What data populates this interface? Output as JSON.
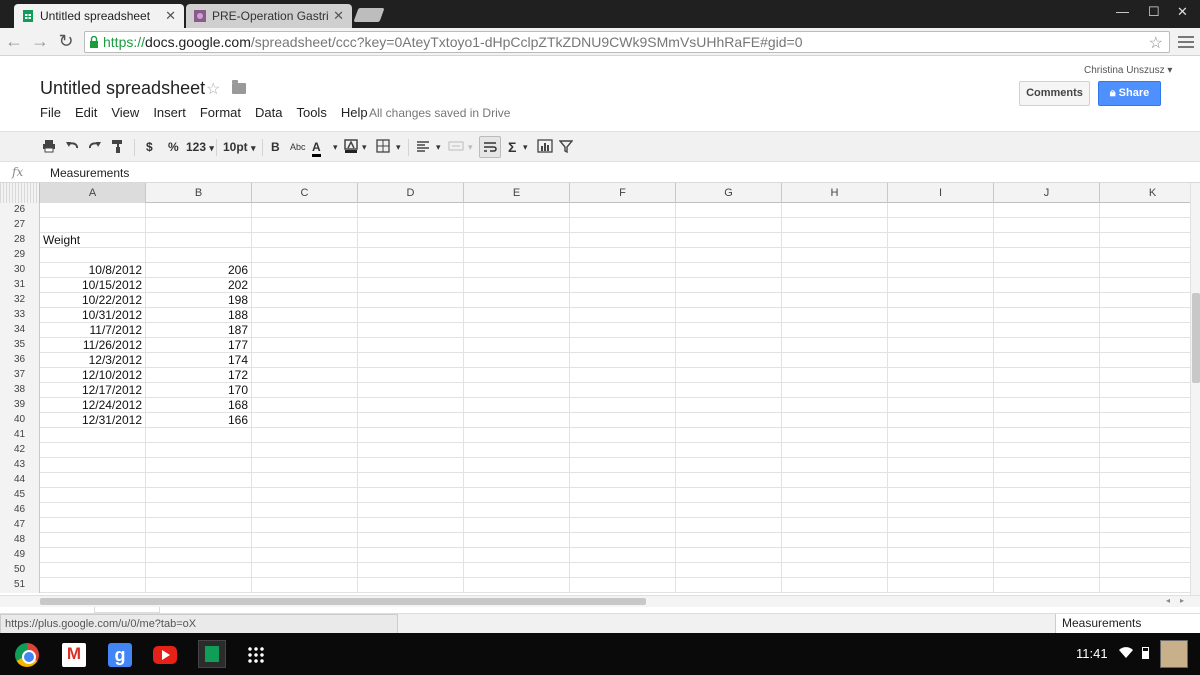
{
  "browser": {
    "tabs": [
      {
        "title": "Untitled spreadsheet",
        "active": true
      },
      {
        "title": "PRE-Operation Gastric Sl",
        "active": false
      }
    ],
    "url": {
      "scheme": "https://",
      "host": "docs.google.com",
      "rest": "/spreadsheet/ccc?key=0AteyTxtoyo1-dHpCclpZTkZDNU9CWk9SMmVsUHhRaFE#gid=0"
    }
  },
  "doc": {
    "title": "Untitled spreadsheet",
    "menu": [
      "File",
      "Edit",
      "View",
      "Insert",
      "Format",
      "Data",
      "Tools",
      "Help"
    ],
    "saved_status": "All changes saved in Drive",
    "user": "Christina Unszusz",
    "comments_label": "Comments",
    "share_label": "Share"
  },
  "toolbar": {
    "currency": "$",
    "percent": "%",
    "number_format": "123",
    "font_size": "10pt",
    "bold": "B",
    "strike": "Abc",
    "text_color": "A",
    "sum": "Σ"
  },
  "formula_bar": {
    "fx": "fx",
    "content": "Measurements"
  },
  "grid": {
    "columns": [
      "A",
      "B",
      "C",
      "D",
      "E",
      "F",
      "G",
      "H",
      "I",
      "J",
      "K"
    ],
    "selected_column": "A",
    "rows": [
      {
        "num": "26",
        "a": "",
        "b": ""
      },
      {
        "num": "27",
        "a": "",
        "b": ""
      },
      {
        "num": "28",
        "a": "Weight",
        "b": "",
        "a_align": "left"
      },
      {
        "num": "29",
        "a": "",
        "b": ""
      },
      {
        "num": "30",
        "a": "10/8/2012",
        "b": "206"
      },
      {
        "num": "31",
        "a": "10/15/2012",
        "b": "202"
      },
      {
        "num": "32",
        "a": "10/22/2012",
        "b": "198"
      },
      {
        "num": "33",
        "a": "10/31/2012",
        "b": "188"
      },
      {
        "num": "34",
        "a": "11/7/2012",
        "b": "187"
      },
      {
        "num": "35",
        "a": "11/26/2012",
        "b": "177"
      },
      {
        "num": "36",
        "a": "12/3/2012",
        "b": "174"
      },
      {
        "num": "37",
        "a": "12/10/2012",
        "b": "172"
      },
      {
        "num": "38",
        "a": "12/17/2012",
        "b": "170"
      },
      {
        "num": "39",
        "a": "12/24/2012",
        "b": "168"
      },
      {
        "num": "40",
        "a": "12/31/2012",
        "b": "166"
      },
      {
        "num": "41",
        "a": "",
        "b": ""
      },
      {
        "num": "42",
        "a": "",
        "b": ""
      },
      {
        "num": "43",
        "a": "",
        "b": ""
      },
      {
        "num": "44",
        "a": "",
        "b": ""
      },
      {
        "num": "45",
        "a": "",
        "b": ""
      },
      {
        "num": "46",
        "a": "",
        "b": ""
      },
      {
        "num": "47",
        "a": "",
        "b": ""
      },
      {
        "num": "48",
        "a": "",
        "b": ""
      },
      {
        "num": "49",
        "a": "",
        "b": ""
      },
      {
        "num": "50",
        "a": "",
        "b": ""
      },
      {
        "num": "51",
        "a": "",
        "b": ""
      }
    ]
  },
  "status": {
    "hover_url": "https://plus.google.com/u/0/me?tab=oX",
    "summary": "Measurements"
  },
  "shelf": {
    "clock": "11:41",
    "gplus_label": "g"
  }
}
